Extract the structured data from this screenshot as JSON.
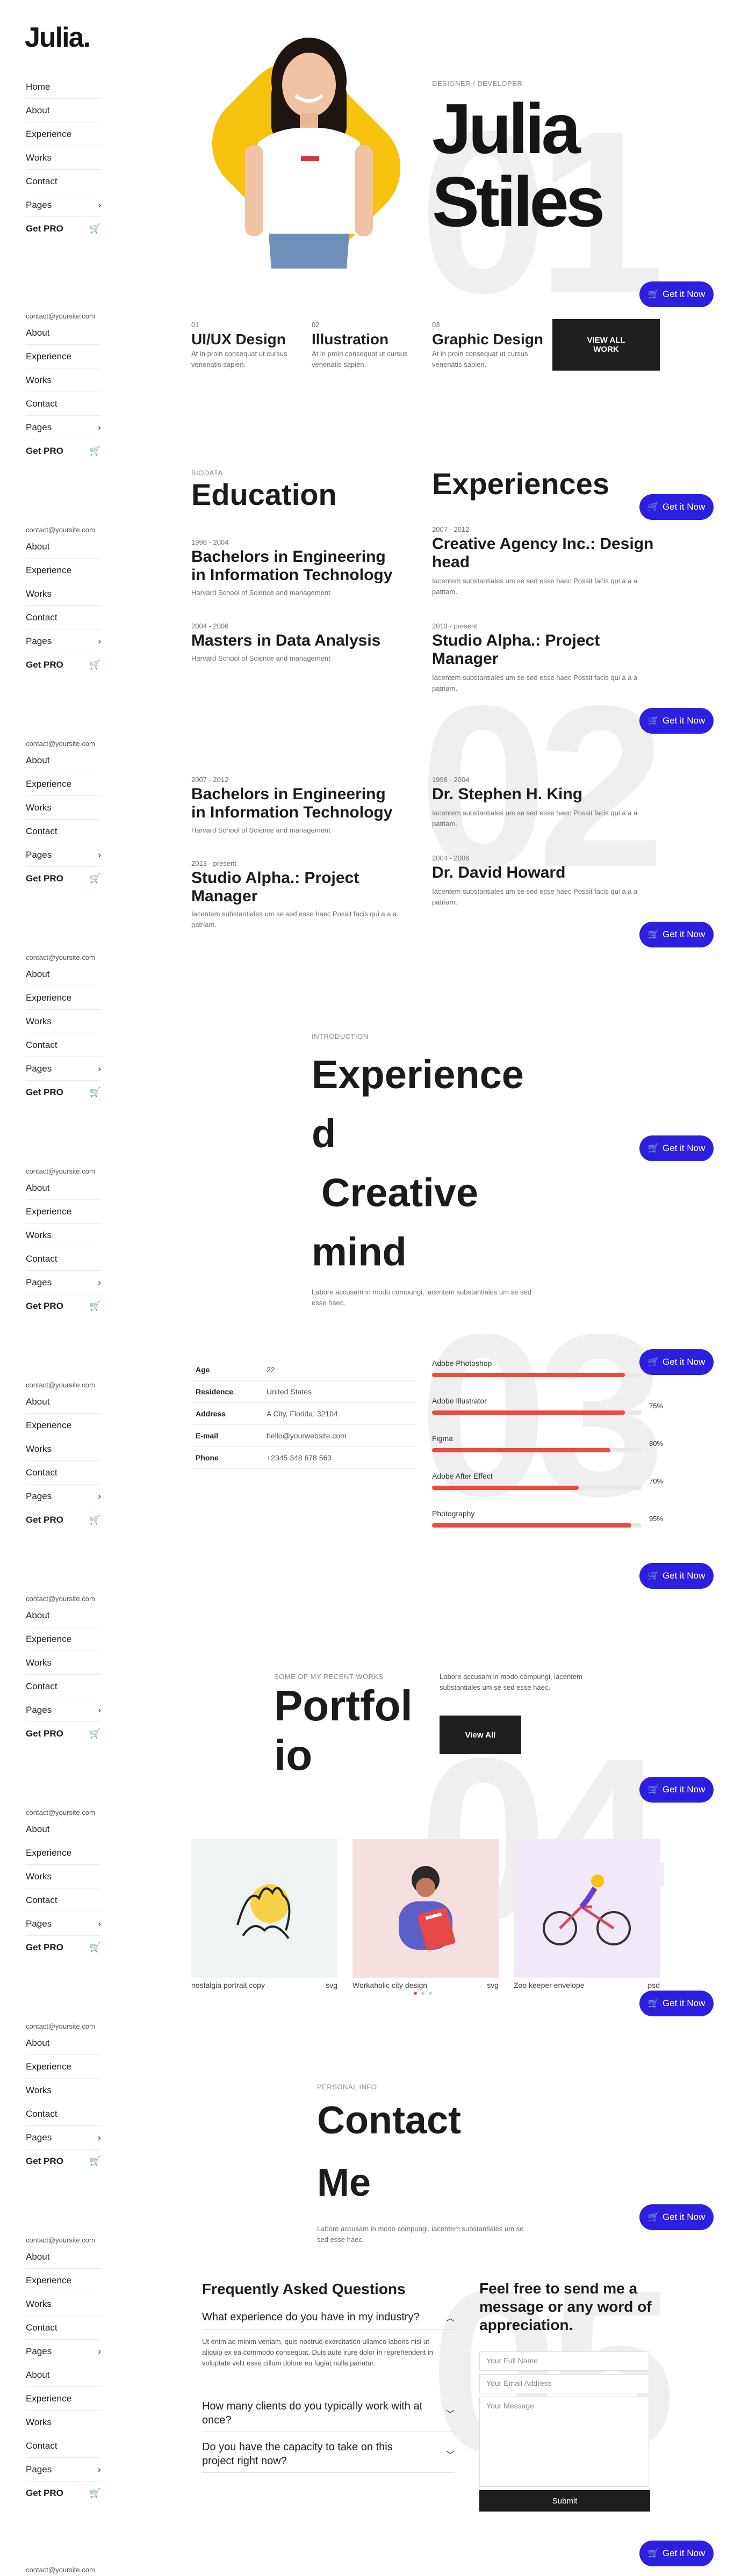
{
  "brand": {
    "logo": "Julia."
  },
  "nav": {
    "items": [
      "Home",
      "About",
      "Experience",
      "Works",
      "Contact",
      "Pages"
    ],
    "band_items": [
      "About",
      "Experience",
      "Works",
      "Contact",
      "Pages"
    ],
    "get_pro": "Get PRO",
    "email": "contact@yoursite.com",
    "extra_items": [
      "About",
      "Experience",
      "Works",
      "Contact",
      "Pages"
    ]
  },
  "cta": {
    "label": "Get it Now"
  },
  "hero": {
    "overline": "DESIGNER / DEVELOPER",
    "first_name": "Julia",
    "last_name": "Stiles",
    "watermark": "01"
  },
  "services": [
    {
      "num": "01",
      "title": "UI/UX Design",
      "text": "At in proin consequat ut cursus venenatis sapien."
    },
    {
      "num": "02",
      "title": "Illustration",
      "text": "At in proin consequat ut cursus venenatis sapien."
    },
    {
      "num": "03",
      "title": "Graphic Design",
      "text": "At in proin consequat ut cursus venenatis sapien."
    }
  ],
  "services_button": "VIEW ALL WORK",
  "education": {
    "overline": "BIODATA",
    "title": "Education",
    "items": [
      {
        "years": "1998 - 2004",
        "degree": "Bachelors in Engineering in Information Technology",
        "school": "Harvard School of Science and management"
      },
      {
        "years": "2004 - 2006",
        "degree": "Masters in Data Analysis",
        "school": "Harvard School of Science and management"
      }
    ]
  },
  "experiences": {
    "title": "Experiences",
    "items": [
      {
        "years": "2007 - 2012",
        "role": "Creative Agency Inc.: Design head",
        "text": "Iacentem substantiales um se sed esse haec Possit facis qui a a a patriam."
      },
      {
        "years": "2013 - present",
        "role": "Studio Alpha.: Project Manager",
        "text": "Iacentem substantiales um se sed esse haec Possit facis qui a a a patriam."
      }
    ]
  },
  "band3": {
    "watermark": "02",
    "left": [
      {
        "years": "2007 - 2012",
        "title": "Bachelors in Engineering in Information Technology",
        "text": "Harvard School of Science and management"
      },
      {
        "years": "2013 - present",
        "title": "Studio Alpha.: Project Manager",
        "text": "Iacentem substantiales um se sed esse haec Possit facis qui a a a patriam."
      }
    ],
    "right": [
      {
        "years": "1998 - 2004",
        "title": "Dr. Stephen H. King",
        "text": "Iacentem substantiales um se sed esse haec Possit facis qui a a a patriam."
      },
      {
        "years": "2004 - 2006",
        "title": "Dr. David Howard",
        "text": "Iacentem substantiales um se sed esse haec Possit facis qui a a a patriam."
      }
    ]
  },
  "intro": {
    "overline": "INTRODUCTION",
    "lines": [
      "Experience",
      "d",
      "Creative",
      "mind"
    ],
    "text": "Labore accusam in modo compungi, iacentem substantiales um se sed esse haec."
  },
  "info": {
    "watermark": "03",
    "rows": [
      {
        "k": "Age",
        "v": "22"
      },
      {
        "k": "Residence",
        "v": "United States"
      },
      {
        "k": "Address",
        "v": "A City, Florida, 32104"
      },
      {
        "k": "E-mail",
        "v": "hello@yourwebsite.com"
      },
      {
        "k": "Phone",
        "v": "+2345 348 678 563"
      }
    ]
  },
  "skills": [
    {
      "name": "Adobe Photoshop",
      "pct_label": "",
      "level": 0.92
    },
    {
      "name": "Adobe Illustrator",
      "pct_label": "75%",
      "level": 0.92
    },
    {
      "name": "Figma",
      "pct_label": "80%",
      "level": 0.85
    },
    {
      "name": "Adobe After Effect",
      "pct_label": "70%",
      "level": 0.7
    },
    {
      "name": "Photography",
      "pct_label": "95%",
      "level": 0.95
    }
  ],
  "portfolio": {
    "watermark": "04",
    "overline": "SOME OF MY RECENT WORKS",
    "title_1": "Portfol",
    "title_2": "io",
    "text": "Labore accusam in modo compungi, iacentem substantiales um se sed esse haec.",
    "button": "View All",
    "cards": [
      {
        "name": "nostalgia portrait copy",
        "ext": "svg",
        "bg": "#eef4f4"
      },
      {
        "name": "Workaholic city design",
        "ext": "svg",
        "bg": "#f6e0df"
      },
      {
        "name": "Zoo keeper envelope",
        "ext": "psd",
        "bg": "#f1e8f8"
      }
    ]
  },
  "contact": {
    "watermark": "05",
    "overline": "PERSONAL INFO",
    "title_1": "Contact",
    "title_2": "Me",
    "text": "Labore accusam in modo compungi, iacentem substantiales um se sed esse haec."
  },
  "faq": {
    "title": "Frequently Asked Questions",
    "open_q": "What experience do you have in my industry?",
    "open_a": "Ut enim ad minim veniam, quis nostrud exercitation ullamco laboris nisi ut aliquip ex ea commodo consequat. Duis aute irure dolor in reprehenderit in voluptate velit esse cillum dolore eu fugiat nulla pariatur.",
    "q2": "How many clients do you typically work with at once?",
    "q3": "Do you have the capacity to take on this project right now?"
  },
  "form": {
    "title": "Feel free to send me a message or any word of appreciation.",
    "name_ph": "Your Full Name",
    "email_ph": "Your Email Address",
    "msg_ph": "Your Message",
    "submit": "Submit"
  },
  "colors": {
    "accent": "#2d1fe0",
    "yellow": "#f6c20d",
    "skill": "#ea4a3f",
    "dark": "#1e1e1e"
  }
}
